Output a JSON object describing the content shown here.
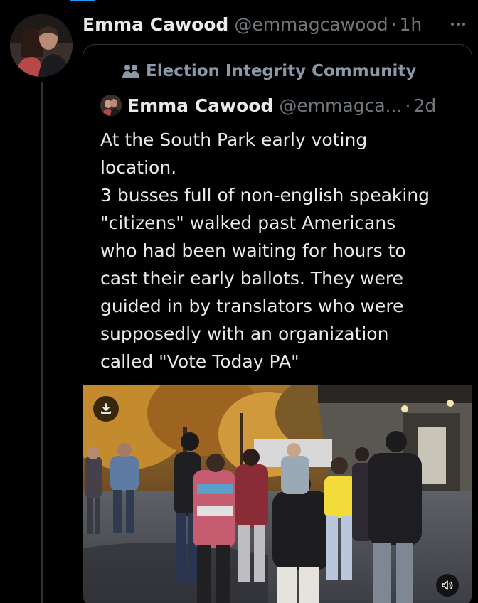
{
  "post": {
    "author_name": "Emma Cawood",
    "author_handle": "@emmagcawood",
    "separator": "·",
    "time": "1h"
  },
  "quoted": {
    "community": "Election Integrity Community",
    "author_name": "Emma Cawood",
    "author_handle": "@emmagca...",
    "separator": "·",
    "time": "2d",
    "text": "At the South Park early voting\nlocation.\n3 busses full of non-english speaking\n\"citizens\" walked past Americans\nwho had been waiting for hours to\ncast their early ballots. They were\nguided in by translators who were\nsupposedly with an organization\ncalled \"Vote Today PA\""
  },
  "icons": {
    "more": "more-dots-icon",
    "community": "community-people-icon",
    "download": "download-icon",
    "volume": "volume-icon"
  },
  "colors": {
    "background": "#000000",
    "text_primary": "#e7e9ea",
    "text_secondary": "#71767b",
    "border": "#2f3336",
    "accent": "#1d9bf0"
  }
}
